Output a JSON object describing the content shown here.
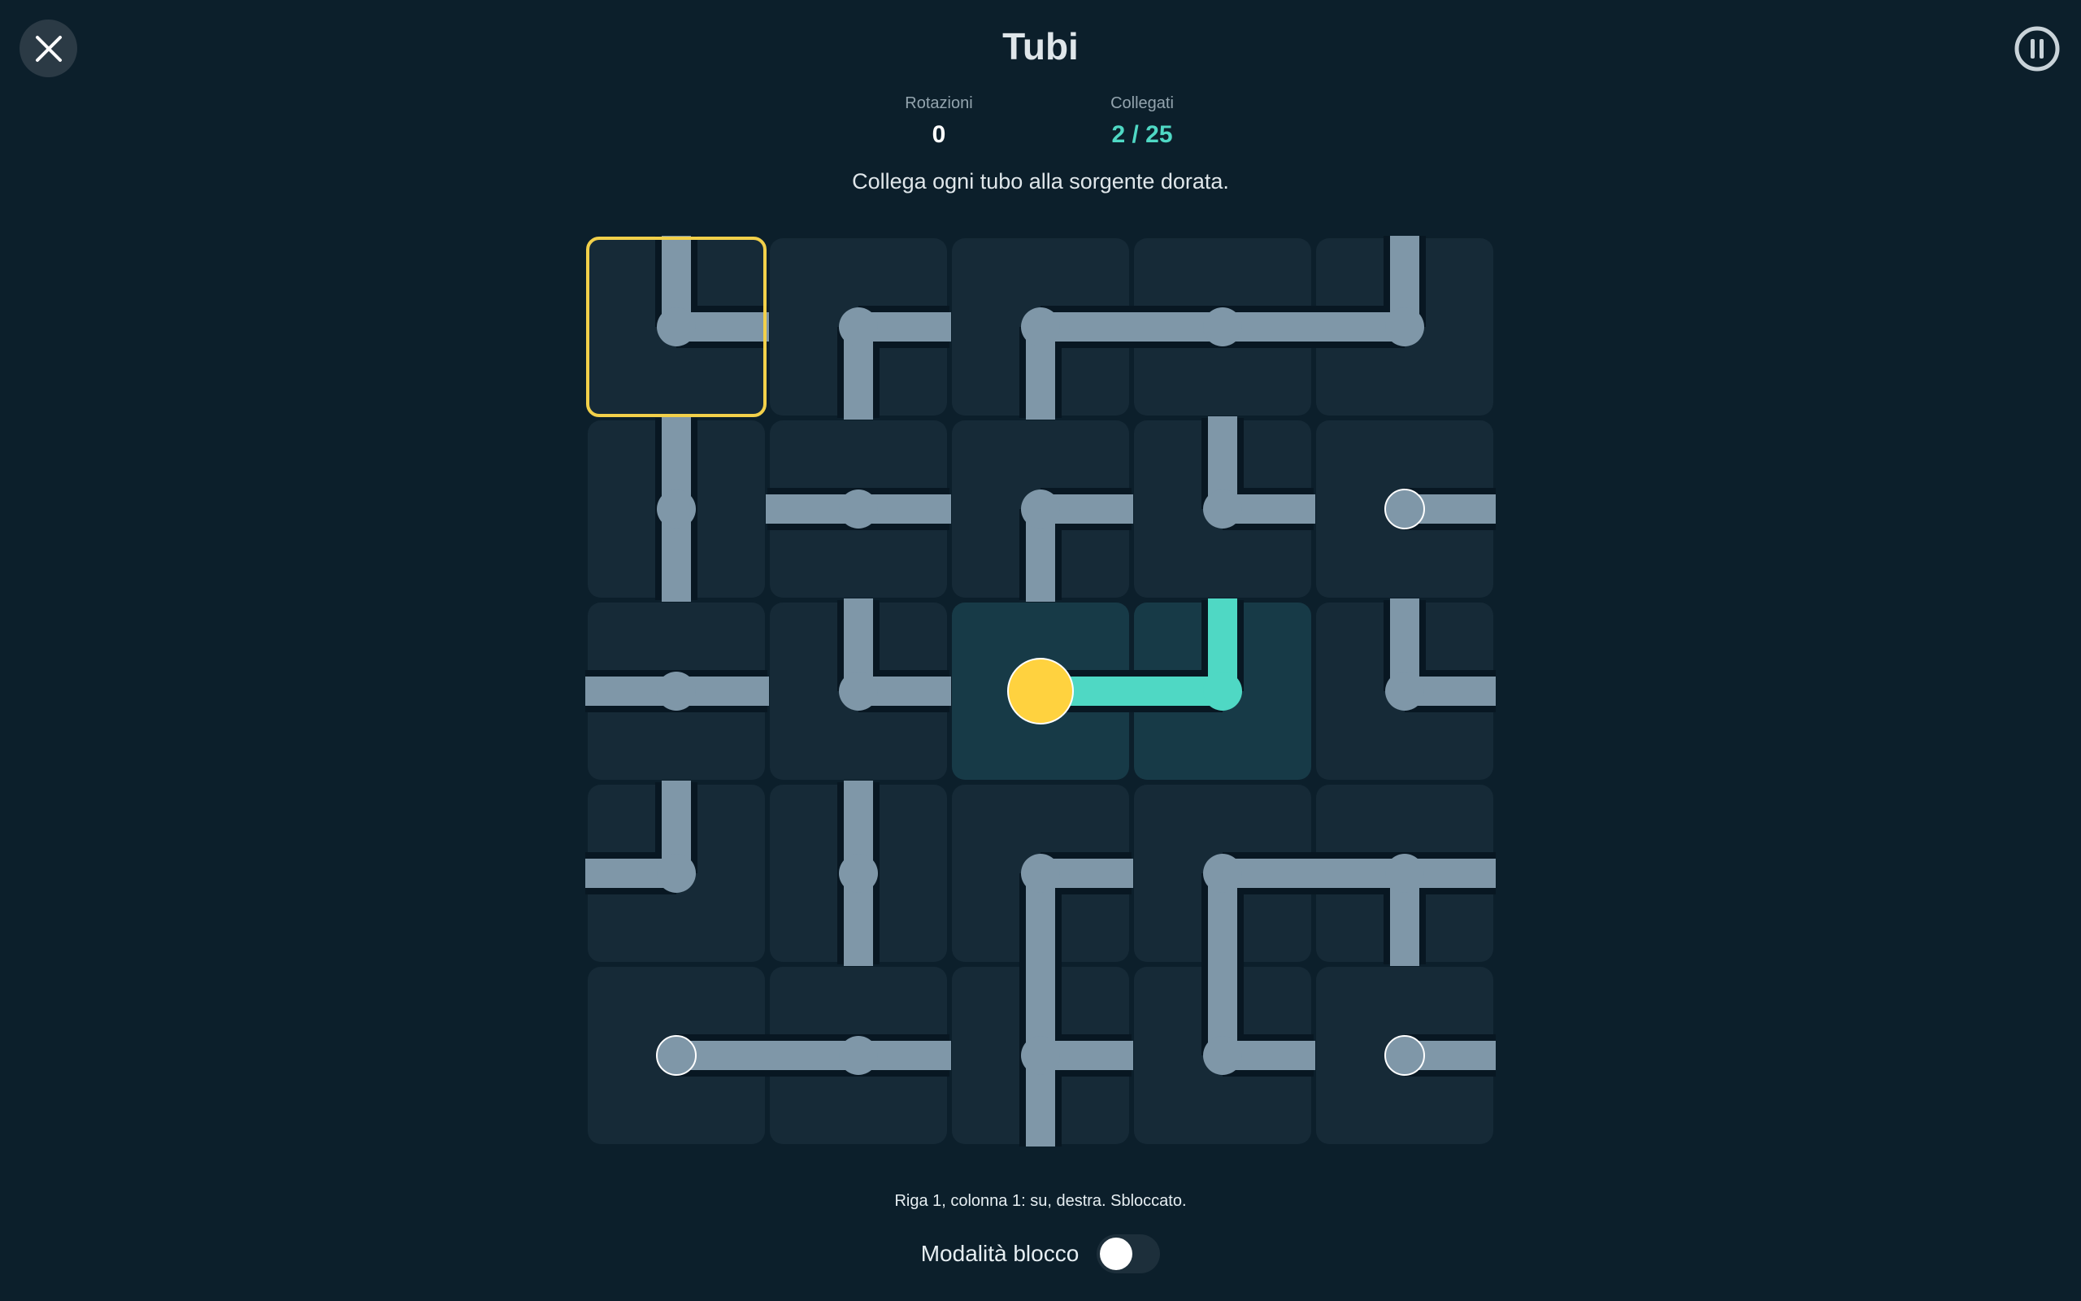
{
  "header": {
    "title": "Tubi",
    "close_icon": "close-icon",
    "pause_icon": "pause-icon"
  },
  "stats": {
    "rotations_label": "Rotazioni",
    "rotations_value": "0",
    "connected_label": "Collegati",
    "connected_value": "2 / 25"
  },
  "instruction": "Collega ogni tubo alla sorgente dorata.",
  "colors": {
    "background": "#0c1f2b",
    "tile": "#162a37",
    "tile_connected": "#173a47",
    "pipe": "#7f97a8",
    "pipe_connected": "#4fd8c4",
    "source": "#ffd23f",
    "selection": "#f2d04a"
  },
  "board": {
    "rows": 5,
    "cols": 5,
    "selected": [
      0,
      0
    ],
    "tiles": [
      [
        {
          "d": [
            "up",
            "right"
          ]
        },
        {
          "d": [
            "right",
            "down"
          ]
        },
        {
          "d": [
            "right",
            "down"
          ]
        },
        {
          "d": [
            "left",
            "right"
          ]
        },
        {
          "d": [
            "up",
            "left"
          ]
        }
      ],
      [
        {
          "d": [
            "up",
            "down"
          ]
        },
        {
          "d": [
            "left",
            "right"
          ]
        },
        {
          "d": [
            "right",
            "down"
          ]
        },
        {
          "d": [
            "up",
            "right"
          ]
        },
        {
          "d": [
            "right"
          ],
          "end": true
        }
      ],
      [
        {
          "d": [
            "left",
            "right"
          ]
        },
        {
          "d": [
            "up",
            "right"
          ]
        },
        {
          "d": [
            "right"
          ],
          "source": true,
          "connected": true
        },
        {
          "d": [
            "up",
            "left"
          ],
          "connected": true
        },
        {
          "d": [
            "up",
            "right"
          ]
        }
      ],
      [
        {
          "d": [
            "up",
            "left"
          ]
        },
        {
          "d": [
            "up",
            "down"
          ]
        },
        {
          "d": [
            "right",
            "down"
          ]
        },
        {
          "d": [
            "right",
            "down"
          ]
        },
        {
          "d": [
            "left",
            "right",
            "down"
          ]
        }
      ],
      [
        {
          "d": [
            "right"
          ],
          "end": true
        },
        {
          "d": [
            "left",
            "right"
          ]
        },
        {
          "d": [
            "up",
            "right",
            "down"
          ]
        },
        {
          "d": [
            "up",
            "right"
          ]
        },
        {
          "d": [
            "right"
          ],
          "end": true
        }
      ]
    ]
  },
  "status_line": "Riga 1, colonna 1: su, destra. Sbloccato.",
  "lock_mode": {
    "label": "Modalità blocco",
    "enabled": false
  }
}
